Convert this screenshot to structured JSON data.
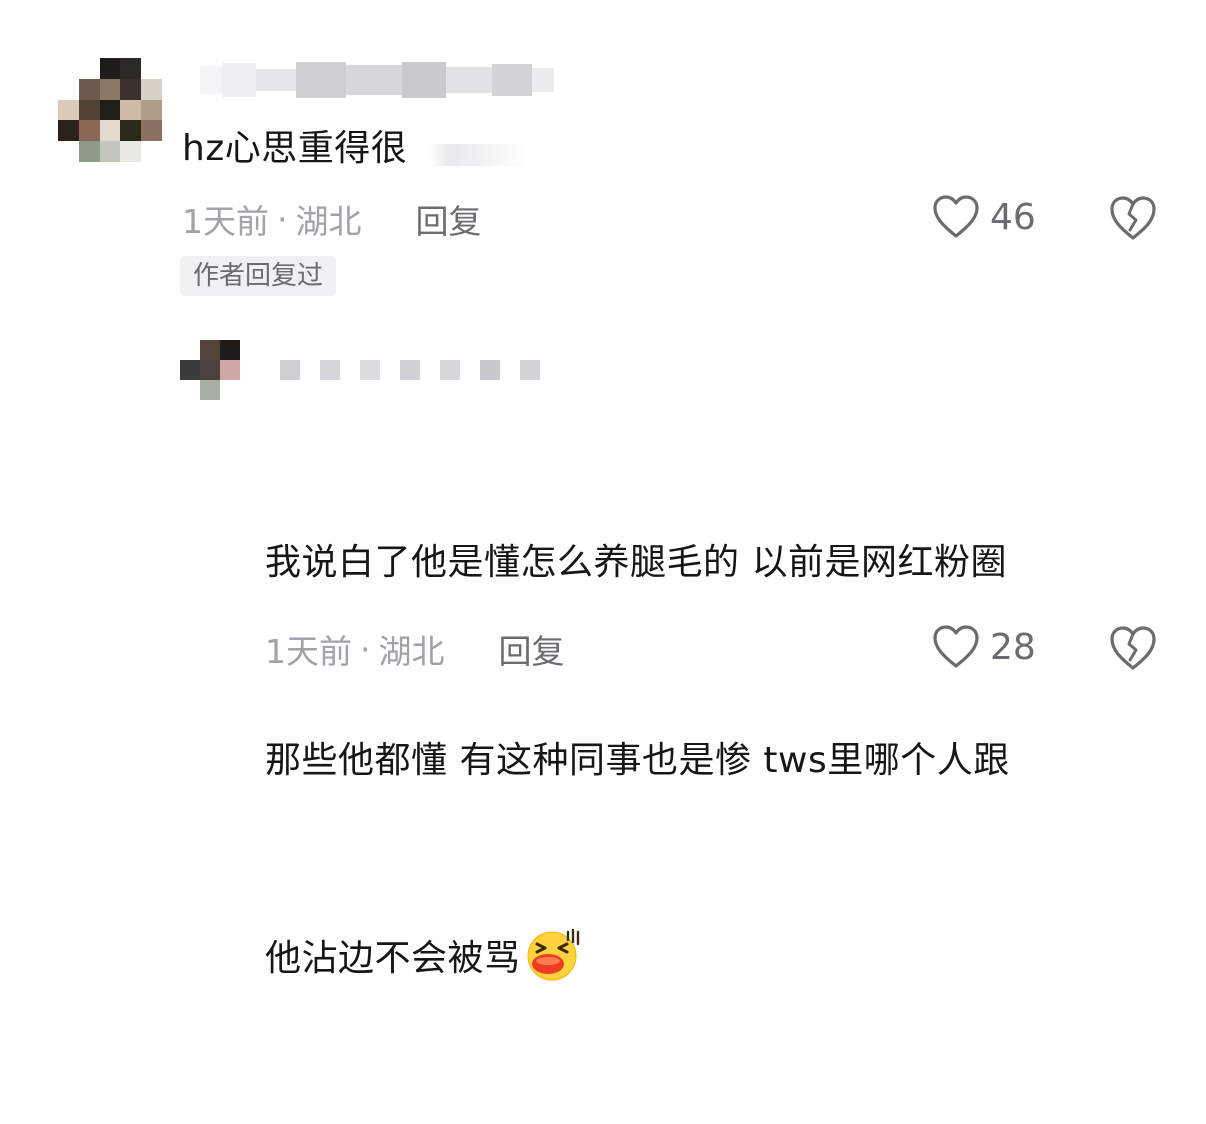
{
  "comments": [
    {
      "text": "hz心思重得很",
      "time": "1天前",
      "separator": "·",
      "location": "湖北",
      "reply_label": "回复",
      "likes": "46",
      "badge": "作者回复过",
      "icons": [
        "heart-outline-icon",
        "broken-heart-icon"
      ]
    },
    {
      "lines": [
        "我说白了他是懂怎么养腿毛的 以前是网红粉圈",
        "那些他都懂 有这种同事也是惨 tws里哪个人跟",
        "他沾边不会被骂"
      ],
      "emoji": "laughing-face-emoji",
      "time": "1天前",
      "separator": "·",
      "location": "湖北",
      "reply_label": "回复",
      "likes": "28",
      "icons": [
        "heart-outline-icon",
        "broken-heart-icon"
      ]
    }
  ],
  "colors": {
    "text": "#161616",
    "meta": "#a2a2a8",
    "action": "#6b6b70",
    "badge_bg": "#f1f1f4"
  }
}
